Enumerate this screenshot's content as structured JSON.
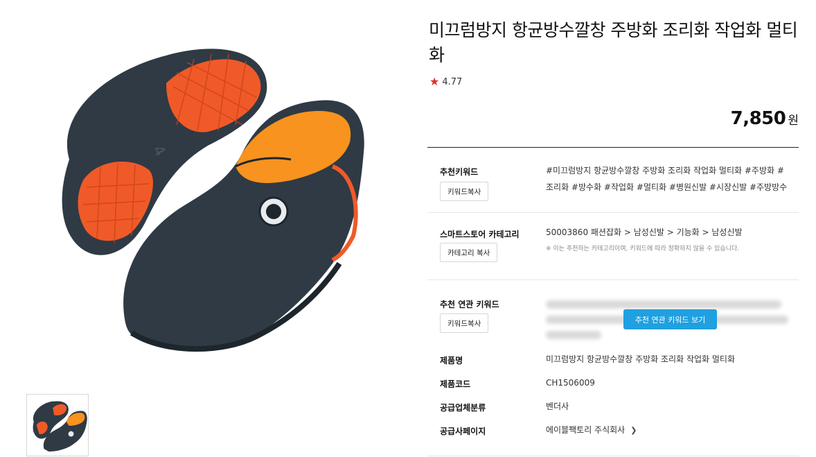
{
  "product": {
    "title": "미끄럼방지 항균방수깔창 주방화 조리화 작업화 멀티화",
    "rating_icon": "star-icon",
    "rating": "4.77",
    "price": "7,850",
    "currency": "원"
  },
  "details": {
    "keyword": {
      "label": "추천키워드",
      "button": "키워드복사",
      "value": "#미끄럼방지 항균방수깔창 주방화 조리화 작업화 멀티화 #주방화 #조리화 #방수화 #작업화 #멀티화 #병원신발 #시장신발 #주방방수"
    },
    "category": {
      "label": "스마트스토어 카테고리",
      "button": "카테고리 복사",
      "value": "50003860 패션잡화 > 남성신발 > 기능화 > 남성신발",
      "note": "※ 이는 추천하는 카테고리이며, 키워드에 따라 정확하지 않을 수 있습니다."
    },
    "related": {
      "label": "추천 연관 키워드",
      "button": "키워드복사",
      "cta": "추천 연관 키워드 보기"
    },
    "product_name": {
      "label": "제품명",
      "value": "미끄럼방지 항균방수깔창 주방화 조리화 작업화 멀티화"
    },
    "product_code": {
      "label": "제품코드",
      "value": "CH1506009"
    },
    "supplier_type": {
      "label": "공급업체분류",
      "value": "벤더사"
    },
    "supplier_page": {
      "label": "공급사페이지",
      "value": "에이블팩토리 주식회사",
      "icon": "chevron-right-icon"
    }
  },
  "colors": {
    "accent": "#1fa0e0",
    "star": "#e62a2a",
    "shoe_body": "#2f3a44",
    "shoe_sole": "#f05a28",
    "shoe_insole": "#f7931e"
  }
}
